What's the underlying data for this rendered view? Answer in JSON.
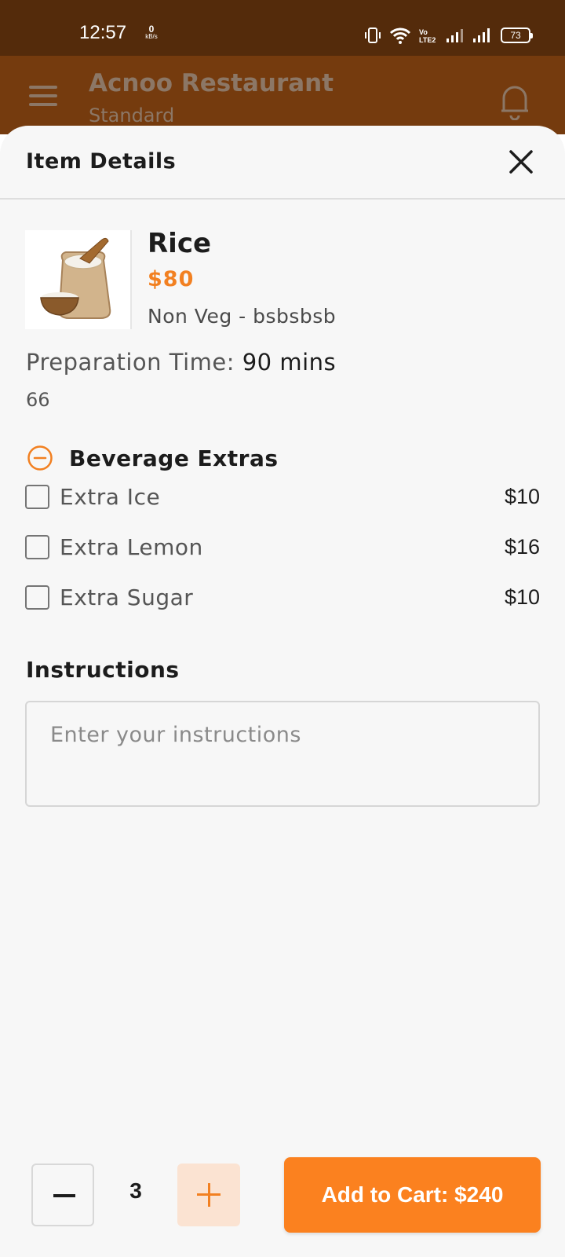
{
  "status_bar": {
    "time": "12:57",
    "speed_value": "0",
    "speed_unit": "kB/s",
    "battery": "73"
  },
  "app_bar": {
    "title": "Acnoo Restaurant",
    "subtitle": "Standard"
  },
  "sheet": {
    "title": "Item Details",
    "item": {
      "name": "Rice",
      "price": "$80",
      "category": "Non Veg - bsbsbsb",
      "prep_label": "Preparation Time:",
      "prep_value": "90 mins",
      "description": "66"
    },
    "extras": {
      "title": "Beverage Extras",
      "items": [
        {
          "name": "Extra Ice",
          "price": "$10",
          "checked": false
        },
        {
          "name": "Extra Lemon",
          "price": "$16",
          "checked": false
        },
        {
          "name": "Extra Sugar",
          "price": "$10",
          "checked": false
        }
      ]
    },
    "instructions": {
      "label": "Instructions",
      "placeholder": "Enter your instructions",
      "value": ""
    },
    "quantity": 3,
    "add_to_cart_label": "Add to Cart: $240"
  },
  "colors": {
    "accent": "#fb811f",
    "price": "#f28021",
    "status_bar": "#542b0b",
    "app_bar": "#753b0e"
  }
}
